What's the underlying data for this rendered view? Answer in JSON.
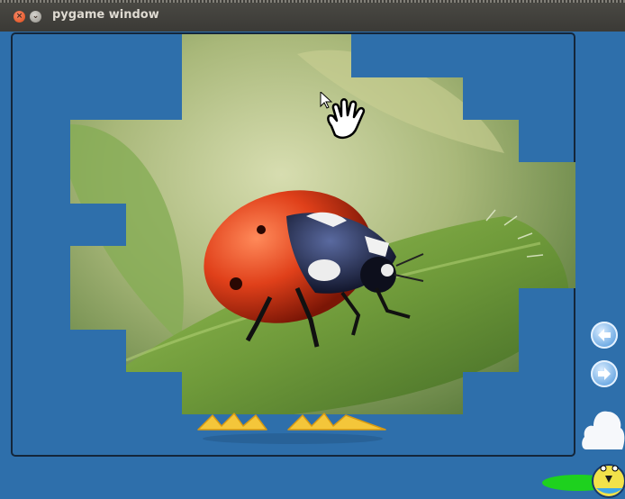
{
  "window": {
    "title": "pygame window"
  },
  "game": {
    "puzzle_image": "ladybug-on-leaf",
    "controls": {
      "previous_icon": "arrow-left-icon",
      "next_icon": "arrow-right-icon"
    },
    "colors": {
      "background": "#2e6fab",
      "frame_border": "#14263a",
      "button": "#6aa8e3"
    }
  }
}
